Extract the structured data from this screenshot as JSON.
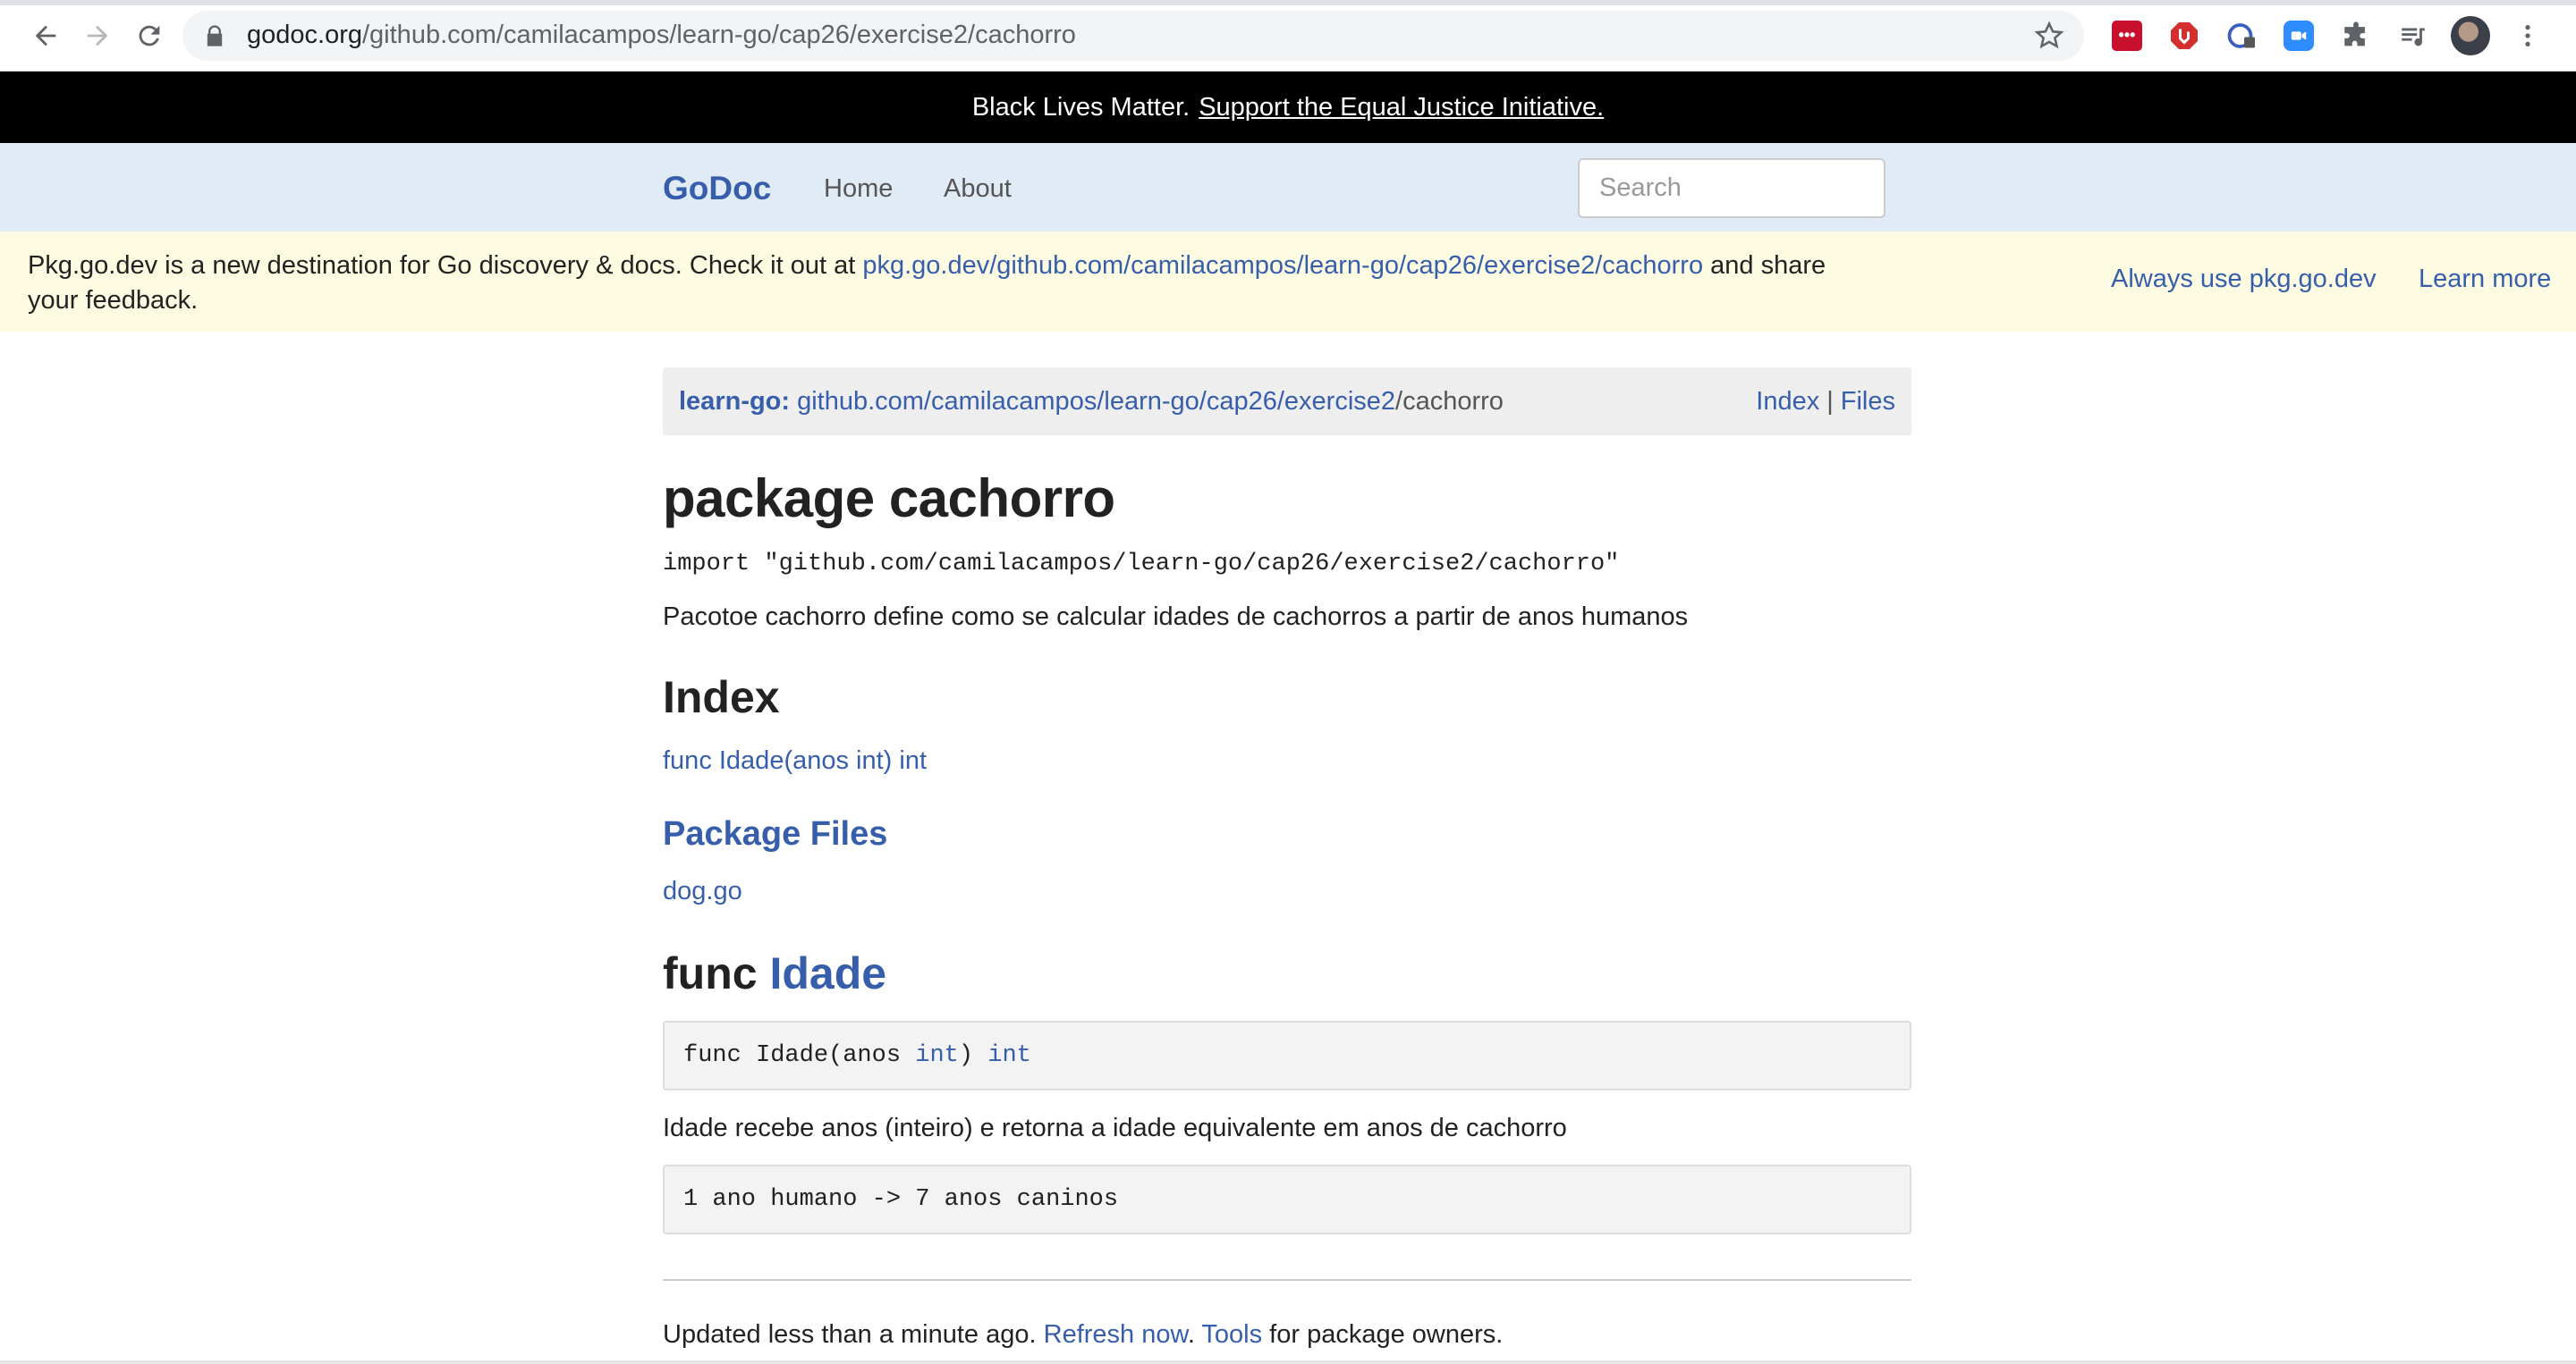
{
  "browser": {
    "url_host": "godoc.org",
    "url_path": "/github.com/camilacampos/learn-go/cap26/exercise2/cachorro"
  },
  "blm": {
    "text": "Black Lives Matter.",
    "link": "Support the Equal Justice Initiative."
  },
  "navbar": {
    "brand": "GoDoc",
    "home": "Home",
    "about": "About",
    "search_placeholder": "Search"
  },
  "notice": {
    "text_before": "Pkg.go.dev is a new destination for Go discovery & docs. Check it out at ",
    "link": "pkg.go.dev/github.com/camilacampos/learn-go/cap26/exercise2/cachorro",
    "text_after": " and share your feedback.",
    "always_use": "Always use pkg.go.dev",
    "learn_more": "Learn more"
  },
  "breadcrumb": {
    "root": "learn-go:",
    "path_link": "github.com/camilacampos/learn-go/cap26/exercise2",
    "current": "/cachorro",
    "index": "Index",
    "separator": "|",
    "files": "Files"
  },
  "package": {
    "title": "package cachorro",
    "import": "import \"github.com/camilacampos/learn-go/cap26/exercise2/cachorro\"",
    "doc": "Pacotoe cachorro define como se calcular idades de cachorros a partir de anos humanos"
  },
  "index": {
    "heading": "Index",
    "items": [
      "func Idade(anos int) int"
    ]
  },
  "package_files": {
    "heading": "Package Files",
    "files": [
      "dog.go"
    ]
  },
  "func": {
    "keyword": "func",
    "name": "Idade",
    "sig_prefix": "func Idade(anos ",
    "sig_type1": "int",
    "sig_mid": ") ",
    "sig_type2": "int",
    "doc": "Idade recebe anos (inteiro) e retorna a idade equivalente em anos de cachorro",
    "example": "1 ano humano -> 7 anos caninos"
  },
  "footer": {
    "text1": "Updated less than a minute ago. ",
    "refresh": "Refresh now",
    "text2": ". ",
    "tools": "Tools",
    "text3": " for package owners."
  },
  "colors": {
    "link": "#375eab",
    "navbar_bg": "#e0ebf5",
    "notice_bg": "#fdfce2",
    "blm_bg": "#000000"
  },
  "icons": [
    "back-arrow-icon",
    "forward-arrow-icon",
    "reload-icon",
    "lock-icon",
    "star-icon",
    "lastpass-icon",
    "adblock-icon",
    "password-manager-icon",
    "zoom-icon",
    "puzzle-icon",
    "media-queue-icon",
    "kebab-menu-icon"
  ]
}
